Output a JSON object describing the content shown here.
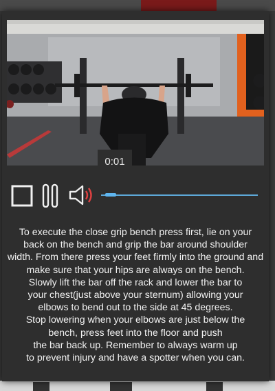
{
  "video": {
    "current_time": "0:01",
    "progress_fraction": 0.03
  },
  "controls": {
    "stop_icon": "stop-square-icon",
    "pause_icon": "pause-icon",
    "volume_icon": "speaker-volume-icon",
    "accent_color": "#5fb6f0"
  },
  "description": {
    "lines": [
      "To execute the close grip bench press first, lie on your",
      "back on the bench and grip the bar around shoulder",
      "width. From there press your feet firmly into the ground and",
      "make sure that your hips are always on the bench.",
      "Slowly lift the bar off the rack and lower the bar to",
      "your chest(just above your sternum) allowing your",
      "elbows to bend out to the side at 45 degrees.",
      "Stop lowering when your elbows are just below the",
      "bench, press feet into the floor and push",
      "the bar back up. Remember to always warm up",
      "to prevent injury and have a spotter when you can."
    ]
  }
}
